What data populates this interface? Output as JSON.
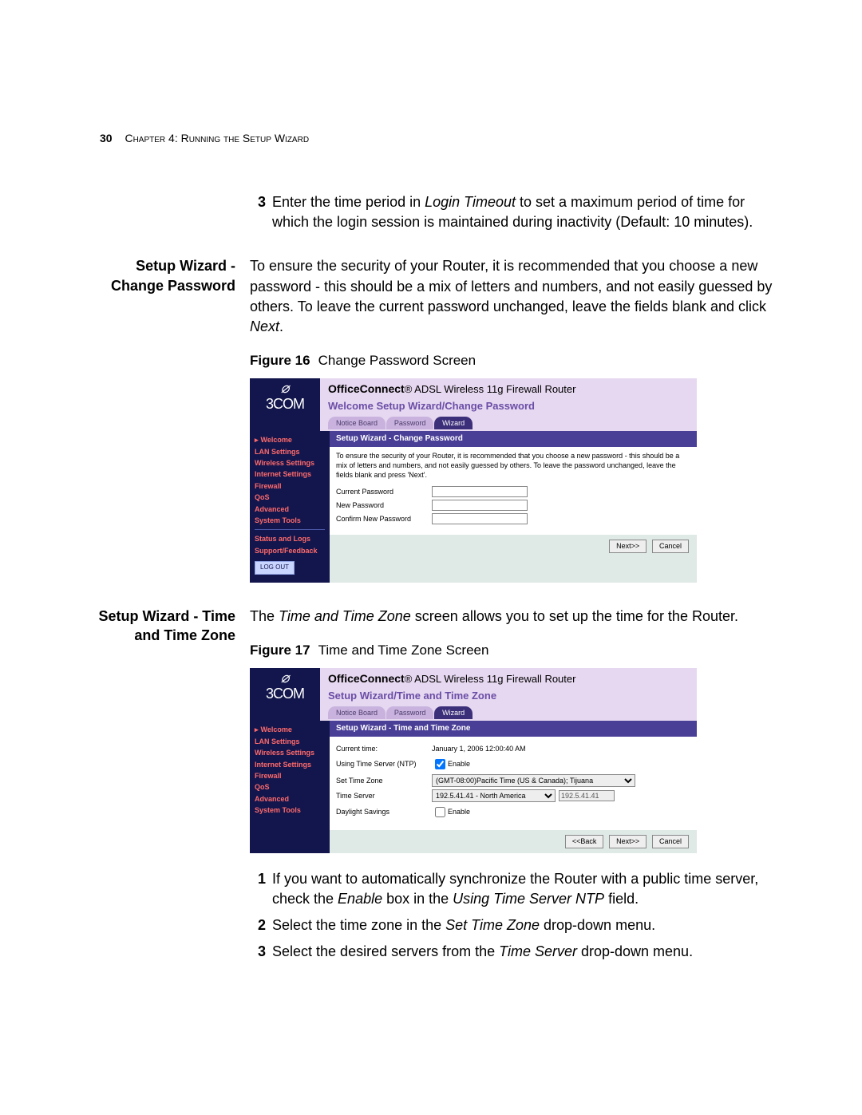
{
  "header": {
    "page_number": "30",
    "chapter": "Chapter 4: Running the Setup Wizard"
  },
  "block1": {
    "num": "3",
    "text_a": "Enter the time period in ",
    "text_i1": "Login Timeout",
    "text_b": " to set a maximum period of time for which the login session is maintained during inactivity (Default: 10 minutes)."
  },
  "section_pw": {
    "heading": "Setup Wizard - Change Password",
    "para_a": "To ensure the security of your Router, it is recommended that you choose a new password - this should be a mix of letters and numbers, and not easily guessed by others. To leave the current password unchanged, leave the fields blank and click ",
    "para_i": "Next",
    "para_b": ".",
    "fig_label": "Figure 16",
    "fig_title": "Change Password Screen"
  },
  "router_pw": {
    "product_bold": "OfficeConnect",
    "product_rest": " ADSL Wireless 11g Firewall Router",
    "subtitle": "Welcome Setup Wizard/Change Password",
    "tabs": {
      "t1": "Notice Board",
      "t2": "Password",
      "t3": "Wizard"
    },
    "nav": {
      "welcome": "Welcome",
      "lan": "LAN Settings",
      "wireless": "Wireless Settings",
      "internet": "Internet Settings",
      "firewall": "Firewall",
      "qos": "QoS",
      "advanced": "Advanced",
      "system": "System Tools",
      "status": "Status and Logs",
      "support": "Support/Feedback",
      "logout": "LOG OUT"
    },
    "panel_title": "Setup Wizard - Change Password",
    "blurb": "To ensure the security of your Router, it is recommended that you choose a new password - this should be a mix of letters and numbers, and not easily guessed by others. To leave the password unchanged, leave the fields blank and press 'Next'.",
    "lbl_current": "Current Password",
    "lbl_new": "New Password",
    "lbl_confirm": "Confirm New Password",
    "btn_next": "Next>>",
    "btn_cancel": "Cancel"
  },
  "section_tz": {
    "heading": "Setup Wizard - Time and Time Zone",
    "para_a": "The ",
    "para_i": "Time and Time Zone",
    "para_b": " screen allows you to set up the time for the Router.",
    "fig_label": "Figure 17",
    "fig_title": "Time and Time Zone Screen"
  },
  "router_tz": {
    "subtitle": "Setup Wizard/Time and Time Zone",
    "panel_title": "Setup Wizard - Time and Time Zone",
    "lbl_current_time": "Current time:",
    "val_current_time": "January 1, 2006 12:00:40 AM",
    "lbl_ntp": "Using Time Server (NTP)",
    "lbl_enable": "Enable",
    "lbl_set_tz": "Set Time Zone",
    "val_tz": "(GMT-08:00)Pacific Time (US & Canada); Tijuana",
    "lbl_time_server": "Time Server",
    "val_ts_sel": "192.5.41.41 - North America",
    "val_ts_ip": "192.5.41.41",
    "lbl_daylight": "Daylight Savings",
    "btn_back": "<<Back",
    "btn_next": "Next>>",
    "btn_cancel": "Cancel"
  },
  "steps_after": {
    "s1": {
      "n": "1",
      "a": "If you want to automatically synchronize the Router with a public time server, check the ",
      "i1": "Enable",
      "b": " box in the ",
      "i2": "Using Time Server NTP",
      "c": " field."
    },
    "s2": {
      "n": "2",
      "a": "Select the time zone in the ",
      "i1": "Set Time Zone",
      "b": " drop-down menu."
    },
    "s3": {
      "n": "3",
      "a": "Select the desired servers from the ",
      "i1": "Time Server",
      "b": " drop-down menu."
    }
  }
}
